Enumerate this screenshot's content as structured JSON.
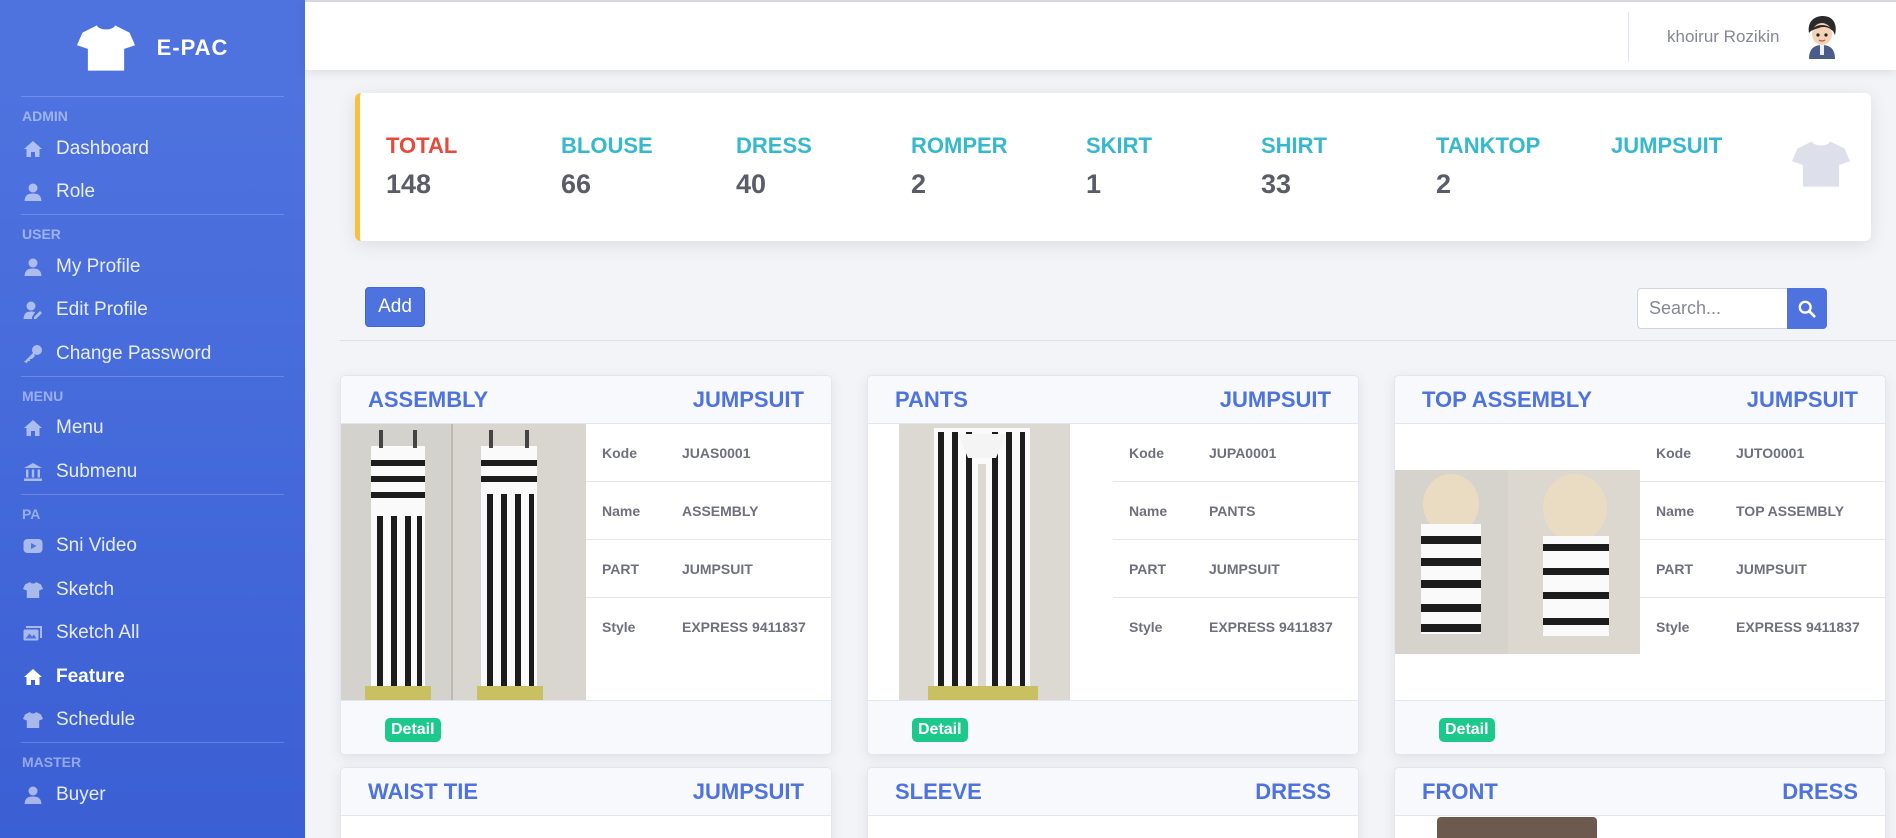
{
  "brand": {
    "name": "E-PAC",
    "icon": "shirt-icon"
  },
  "sidebar": {
    "sections": [
      {
        "heading": "ADMIN",
        "items": [
          {
            "label": "Dashboard",
            "icon": "home-icon"
          },
          {
            "label": "Role",
            "icon": "user-icon"
          }
        ]
      },
      {
        "heading": "USER",
        "items": [
          {
            "label": "My Profile",
            "icon": "user-icon"
          },
          {
            "label": "Edit Profile",
            "icon": "user-edit-icon"
          },
          {
            "label": "Change Password",
            "icon": "key-icon"
          }
        ]
      },
      {
        "heading": "MENU",
        "items": [
          {
            "label": "Menu",
            "icon": "home-icon"
          },
          {
            "label": "Submenu",
            "icon": "bank-icon"
          }
        ]
      },
      {
        "heading": "PA",
        "items": [
          {
            "label": "Sni Video",
            "icon": "video-icon"
          },
          {
            "label": "Sketch",
            "icon": "shirt-icon"
          },
          {
            "label": "Sketch All",
            "icon": "images-icon"
          },
          {
            "label": "Feature",
            "icon": "home-icon",
            "active": true
          },
          {
            "label": "Schedule",
            "icon": "shirt-icon"
          }
        ]
      },
      {
        "heading": "MASTER",
        "items": [
          {
            "label": "Buyer",
            "icon": "user-icon"
          }
        ]
      }
    ]
  },
  "topbar": {
    "user_name": "khoirur Rozikin"
  },
  "stats": [
    {
      "label": "TOTAL",
      "value": "148"
    },
    {
      "label": "BLOUSE",
      "value": "66"
    },
    {
      "label": "DRESS",
      "value": "40"
    },
    {
      "label": "ROMPER",
      "value": "2"
    },
    {
      "label": "SKIRT",
      "value": "1"
    },
    {
      "label": "SHIRT",
      "value": "33"
    },
    {
      "label": "TANKTOP",
      "value": "2"
    },
    {
      "label": "JUMPSUIT",
      "value": ""
    }
  ],
  "toolbar": {
    "add_label": "Add",
    "search_placeholder": "Search..."
  },
  "cards": [
    {
      "title": "ASSEMBLY",
      "part_header": "JUMPSUIT",
      "fields": [
        [
          "Kode",
          "JUAS0001"
        ],
        [
          "Name",
          "ASSEMBLY"
        ],
        [
          "PART",
          "JUMPSUIT"
        ],
        [
          "Style",
          "EXPRESS 9411837"
        ]
      ],
      "detail_label": "Detail"
    },
    {
      "title": "PANTS",
      "part_header": "JUMPSUIT",
      "fields": [
        [
          "Kode",
          "JUPA0001"
        ],
        [
          "Name",
          "PANTS"
        ],
        [
          "PART",
          "JUMPSUIT"
        ],
        [
          "Style",
          "EXPRESS 9411837"
        ]
      ],
      "detail_label": "Detail"
    },
    {
      "title": "TOP ASSEMBLY",
      "part_header": "JUMPSUIT",
      "fields": [
        [
          "Kode",
          "JUTO0001"
        ],
        [
          "Name",
          "TOP ASSEMBLY"
        ],
        [
          "PART",
          "JUMPSUIT"
        ],
        [
          "Style",
          "EXPRESS 9411837"
        ]
      ],
      "detail_label": "Detail"
    },
    {
      "title": "WAIST TIE",
      "part_header": "JUMPSUIT"
    },
    {
      "title": "SLEEVE",
      "part_header": "DRESS"
    },
    {
      "title": "FRONT",
      "part_header": "DRESS"
    }
  ]
}
